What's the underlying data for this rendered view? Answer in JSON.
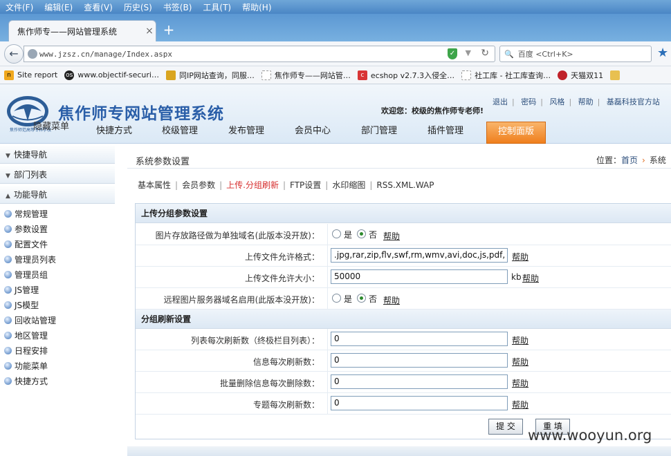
{
  "browser": {
    "menu": [
      "文件(F)",
      "编辑(E)",
      "查看(V)",
      "历史(S)",
      "书签(B)",
      "工具(T)",
      "帮助(H)"
    ],
    "tab_title": "焦作师专——网站管理系统",
    "tab_close": "×",
    "new_tab": "+",
    "url": "www.jzsz.cn/manage/Index.aspx",
    "search_text": "百度 <Ctrl+K>",
    "bookmarks": [
      {
        "label": "Site report",
        "icon": "n",
        "color": "#f0a81e"
      },
      {
        "label": "www.objectif-securi…",
        "icon": "os",
        "color": "#222222"
      },
      {
        "label": "同IP网站查询，同服…",
        "icon": "",
        "color": "#d9a520"
      },
      {
        "label": "焦作师专——网站管…",
        "icon": "",
        "color": "#ffffff"
      },
      {
        "label": "ecshop v2.7.3入侵全…",
        "icon": "c",
        "color": "#d83636"
      },
      {
        "label": "社工库 - 社工库查询…",
        "icon": "",
        "color": "#ffffff"
      },
      {
        "label": "天猫双11",
        "icon": "",
        "color": "#c0222a"
      }
    ]
  },
  "header": {
    "logo_sub": "焦作师范高等专科学校",
    "title": "焦作师专网站管理系统",
    "hide_menu": "隐藏菜单",
    "welcome": "欢迎您：校级的焦作师专老师!",
    "top_links": [
      "退出",
      "密码",
      "风格",
      "帮助",
      "基磊科技官方站"
    ]
  },
  "main_nav": {
    "items": [
      "快捷方式",
      "校级管理",
      "发布管理",
      "会员中心",
      "部门管理",
      "插件管理",
      "控制面版"
    ],
    "active": "控制面版"
  },
  "sidebar": {
    "sections": [
      {
        "label": "快捷导航",
        "arrow": "▼"
      },
      {
        "label": "部门列表",
        "arrow": "▼"
      },
      {
        "label": "功能导航",
        "arrow": "▲"
      }
    ],
    "items": [
      "常规管理",
      "参数设置",
      "配置文件",
      "管理员列表",
      "管理员组",
      "JS管理",
      "JS模型",
      "回收站管理",
      "地区管理",
      "日程安排",
      "功能菜单",
      "快捷方式"
    ]
  },
  "content": {
    "title": "系统参数设置",
    "breadcrumb_prefix": "位置：",
    "breadcrumb_home": "首页",
    "breadcrumb_current": "系统",
    "subtabs": [
      "基本属性",
      "会员参数",
      "上传.分组刷新",
      "FTP设置",
      "水印缩图",
      "RSS.XML.WAP"
    ],
    "active_subtab": "上传.分组刷新"
  },
  "upload_section": {
    "heading": "上传分组参数设置",
    "rows": [
      {
        "label": "图片存放路径做为单独域名(此版本没开放)：",
        "type": "radio",
        "yes": "是",
        "no": "否",
        "selected": "否",
        "help": "帮助"
      },
      {
        "label": "上传文件允许格式：",
        "type": "text",
        "value": ".jpg,rar,zip,flv,swf,rm,wmv,avi,doc,js,pdf,",
        "help": "帮助"
      },
      {
        "label": "上传文件允许大小：",
        "type": "text",
        "value": "50000",
        "unit": "kb",
        "help": "帮助"
      },
      {
        "label": "远程图片服务器域名启用(此版本没开放)：",
        "type": "radio",
        "yes": "是",
        "no": "否",
        "selected": "否",
        "help": "帮助"
      }
    ]
  },
  "refresh_section": {
    "heading": "分组刷新设置",
    "rows": [
      {
        "label": "列表每次刷新数（终极栏目列表）：",
        "value": "0",
        "help": "帮助"
      },
      {
        "label": "信息每次刷新数：",
        "value": "0",
        "help": "帮助"
      },
      {
        "label": "批量删除信息每次删除数：",
        "value": "0",
        "help": "帮助"
      },
      {
        "label": "专题每次刷新数：",
        "value": "0",
        "help": "帮助"
      }
    ]
  },
  "buttons": {
    "submit": "提 交",
    "reset": "重 填"
  },
  "watermark": "www.wooyun.org"
}
